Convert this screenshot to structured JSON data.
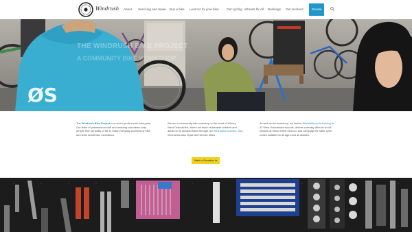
{
  "header": {
    "logo_text": "Windrush",
    "nav": [
      {
        "label": "About"
      },
      {
        "label": "Servicing and repair"
      },
      {
        "label": "Buy a bike"
      },
      {
        "label": "Learn to fix your bike"
      },
      {
        "label": "Get cycling"
      },
      {
        "label": "Wheels for All"
      },
      {
        "label": "Bookings"
      },
      {
        "label": "Get involved"
      }
    ],
    "donate_label": "Donate",
    "search_icon": "search-icon"
  },
  "hero": {
    "title": "THE WINDRUSH BIKE PROJECT",
    "subtitle": "A COMMUNITY BIKE WORKSHOP"
  },
  "columns": [
    {
      "pre": "The ",
      "link": "Windrush Bike Project",
      "post": " is a not-for-profit social enterprise. Our team of professional staff and amazing volunteers help people from all walks of life to make everyday journeys by bike and learn about bike mechanics."
    },
    {
      "pre": "We run a community bike workshop in the heart of Witney, West Oxfordshire, where we teach vulnerable children and adults to fix donated bikes through our ",
      "link": "mechanics courses",
      "post": ". Our mechanics also repair and service bikes."
    },
    {
      "pre": "As well as the workshop, we deliver ",
      "link": "Bikeability cycle training",
      "post": " in 42 West Oxfordshire schools, deliver a weekly Wheels for All session at Wood Green School, and campaign for safer cycle routes suitable for all ages and all abilities."
    }
  ],
  "cta_label": "Make a Donation ➔",
  "colors": {
    "accent": "#2196c8",
    "cta": "#f0d21e"
  }
}
